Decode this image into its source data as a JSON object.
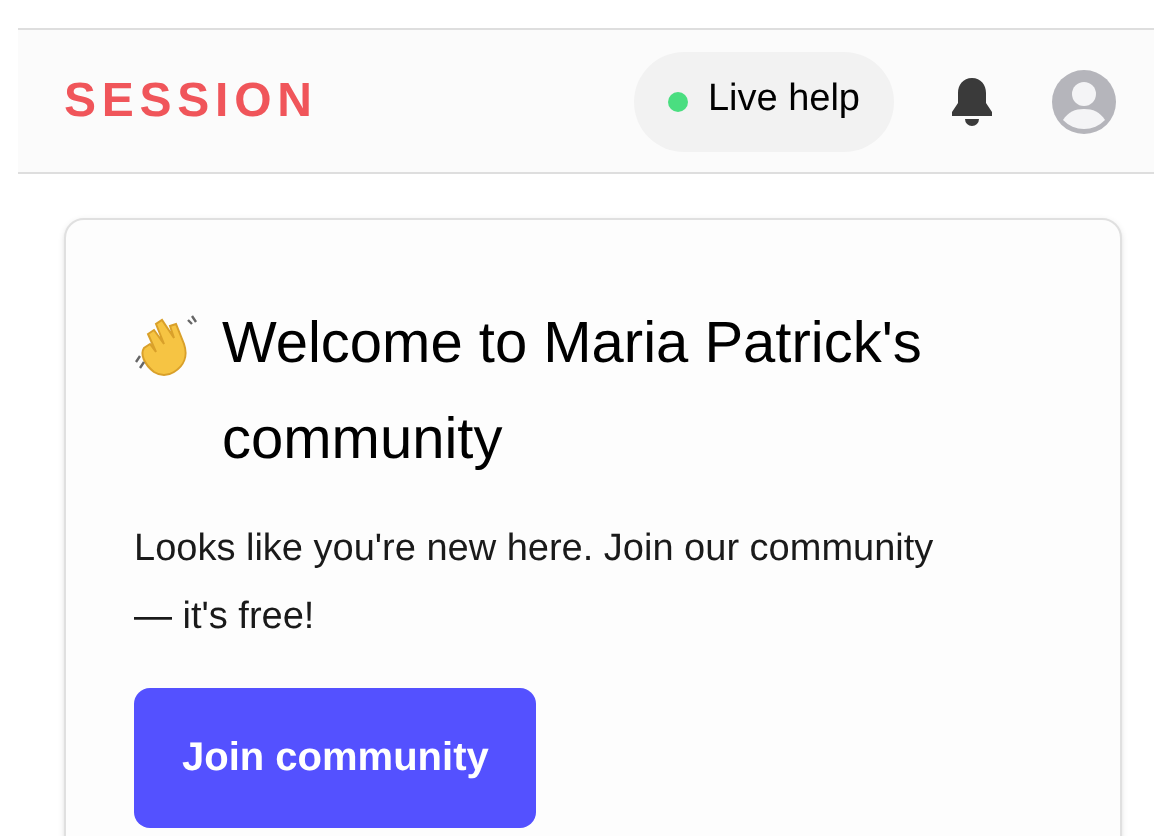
{
  "header": {
    "logo": "SESSION",
    "live_help": {
      "label": "Live help",
      "online": true
    }
  },
  "welcome_card": {
    "title": "Welcome to Maria Patrick's community",
    "message": "Looks like you're new here. Join our community — it's free!",
    "button": "Join community"
  }
}
